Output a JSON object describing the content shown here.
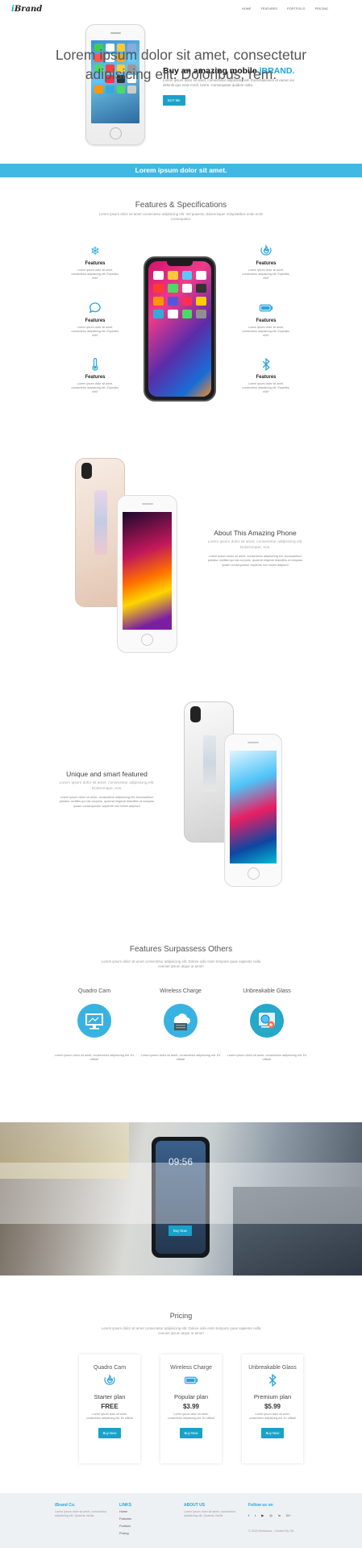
{
  "brand": {
    "prefix": "i",
    "name": "Brand"
  },
  "nav": [
    "HOME",
    "FEATURES",
    "PORTFOLIO",
    "PRICING"
  ],
  "hero": {
    "title": "Buy an amazing mobile ",
    "title_highlight": "|BRAND.",
    "text": "Lorem ipsum dolor sit amet, consectetur adipisicing elit. Exercitationem et earum ea deleniti quo esse modi, lorem. Consequatur quidem nulla.",
    "button": "BUY Me"
  },
  "band": "Lorem ipsum dolor sit amet.",
  "specs": {
    "title": "Features & Specifications",
    "subtitle": "Lorem ipsum dolor sit amet consectetur adipisicing elit. Vel quaerat, doloremque! Voluptatibus unde enim consequatur.",
    "items": [
      {
        "icon": "snowflake-icon",
        "title": "Features",
        "text": "Lorem ipsum dolor sit amet, consectetur adipisicing elit. Expedita, elitt?"
      },
      {
        "icon": "fire-icon",
        "title": "Features",
        "text": "Lorem ipsum dolor sit amet, consectetur adipisicing elit. Expedita, elitt?"
      },
      {
        "icon": "chat-icon",
        "title": "Features",
        "text": "Lorem ipsum dolor sit amet, consectetur adipisicing elit. Expedita, elitt?"
      },
      {
        "icon": "battery-icon",
        "title": "Features",
        "text": "Lorem ipsum dolor sit amet, consectetur adipisicing elit. Expedita, elitt?"
      },
      {
        "icon": "thermometer-icon",
        "title": "Features",
        "text": "Lorem ipsum dolor sit amet, consectetur adipisicing elit. Expedita, elitt?"
      },
      {
        "icon": "bluetooth-icon",
        "title": "Features",
        "text": "Lorem ipsum dolor sit amet, consectetur adipisicing elit. Expedita, elitt?"
      }
    ]
  },
  "about": {
    "title": "About This Amazing Phone",
    "subtitle": "Lorem ipsum dolor sit amet, consectetur adipisicing elit. Doloremque, eos.",
    "text": "Lorem ipsum dolor sit amet, consectetur adipisicing elit. Accusantium pariatur mollitia qui nisi corporis, quaerat eligendi blanditiis ut voluptas ipsam consequuntur sapiente non totam adipisci!"
  },
  "unique": {
    "title": "Unique and smart featured",
    "subtitle": "Lorem ipsum dolor sit amet, consectetur adipisicing elit. Doloremque, eos.",
    "text": "Lorem ipsum dolor sit amet, consectetur adipisicing elit. Accusantium pariatur mollitia qui nisi corporis, quaerat eligendi blanditiis ut voluptas ipsam consequuntur sapiente non totam adipisci!"
  },
  "surpass": {
    "title": "Features Surpassess Others",
    "subtitle": "Lorem ipsum dolor sit amet consectetur adipisicing elit. Dolore odio enim tempore quae sapiente nulla eveniet ipsum atque ut amet!",
    "items": [
      {
        "title": "Quadro Cam",
        "icon": "monitor-icon",
        "text": "Lorem ipsum dolor sit amet, consectetur adipisicing elit. Ex officia!"
      },
      {
        "title": "Wireless Charge",
        "icon": "cloud-server-icon",
        "text": "Lorem ipsum dolor sit amet, consectetur adipisicing elit. Ex officia!"
      },
      {
        "title": "Unbreakable Glass",
        "icon": "gear-globe-icon",
        "text": "Lorem ipsum dolor sit amet, consectetur adipisicing elit. Ex officia!"
      }
    ]
  },
  "banner": {
    "text": "Lorem ipsum dolor sit amet, consectetur adipisicing elit. Doloribus, rem.",
    "button": "Buy Now",
    "phone_time": "09:56"
  },
  "pricing": {
    "title": "Pricing",
    "subtitle": "Lorem ipsum dolor sit amet consectetur adipisicing elit. Dolore odio enim tempore quae sapiente nulla eveniet ipsum atque ut amet!",
    "plans": [
      {
        "title": "Quadro Cam",
        "icon": "fire-icon",
        "plan": "Starter plan",
        "price": "FREE",
        "text": "Lorem ipsum dolor sit amet, consectetur adipisicing elit. Ex officia!",
        "button": "Buy Now"
      },
      {
        "title": "Wireless Charge",
        "icon": "battery-icon",
        "plan": "Popular plan",
        "price": "$3.99",
        "text": "Lorem ipsum dolor sit amet, consectetur adipisicing elit. Ex officia!",
        "button": "Buy Now"
      },
      {
        "title": "Unbreakable Glass",
        "icon": "bluetooth-icon",
        "plan": "Premium plan",
        "price": "$5.99",
        "text": "Lorem ipsum dolor sit amet, consectetur adipisicing elit. Ex officia!",
        "button": "Buy Now"
      }
    ]
  },
  "footer": {
    "company": {
      "title": "iBrand Co.",
      "text": "Lorem ipsum dolor sit amet, consectetur adipisicing elit. Quaerat, facilis"
    },
    "links": {
      "title": "LINKS",
      "items": [
        "Home",
        "Features",
        "Portfolio",
        "Pricing"
      ]
    },
    "about": {
      "title": "ABOUT US",
      "text": "Lorem ipsum dolor sit amet, consectetur adipisicing elit. Quaerat, facilis"
    },
    "follow": {
      "title": "Follow us on",
      "icons": [
        "facebook-icon",
        "twitter-icon",
        "youtube-icon",
        "instagram-icon",
        "linkedin-icon",
        "google-plus-icon"
      ],
      "glyphs": [
        "f",
        "t",
        "▶",
        "◎",
        "in",
        "G+"
      ]
    },
    "copyright": "© 2018 WebAlana - Created By SN"
  },
  "colors": {
    "accent": "#3fb8e3",
    "button": "#1aa1c9"
  }
}
